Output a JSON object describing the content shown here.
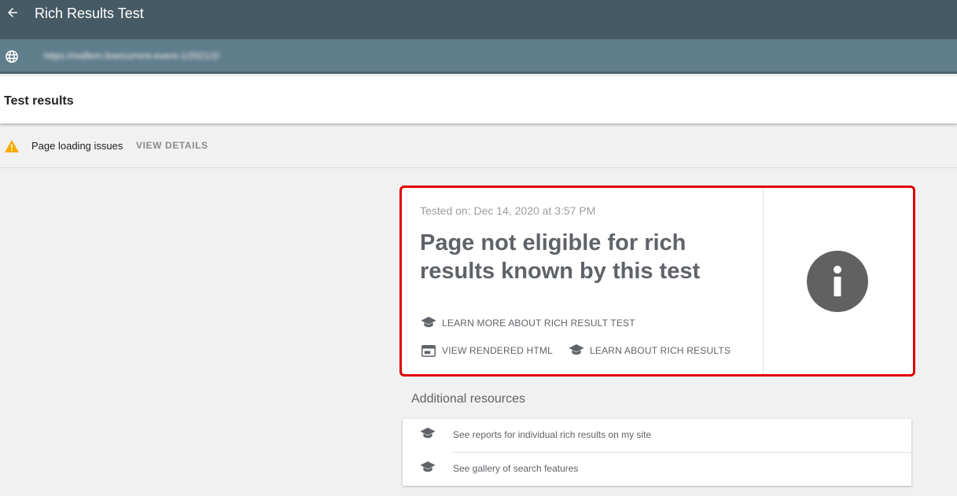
{
  "app": {
    "title": "Rich Results Test",
    "back_icon": "arrow-left-icon"
  },
  "url_bar": {
    "icon": "globe-icon",
    "url": "https://redfern.live/current-event-1/2021/2/"
  },
  "results_header": {
    "title": "Test results"
  },
  "issues": {
    "icon": "warning-icon",
    "text": "Page loading issues",
    "action": "VIEW DETAILS",
    "icon_color": "#f9ab00"
  },
  "result_card": {
    "tested_on": "Tested on: Dec 14, 2020 at 3:57 PM",
    "headline": "Page not eligible for rich results known by this test",
    "links": [
      {
        "label": "LEARN MORE ABOUT RICH RESULT TEST",
        "icon": "graduation-cap-icon"
      },
      {
        "label": "VIEW RENDERED HTML",
        "icon": "browser-window-icon"
      },
      {
        "label": "LEARN ABOUT RICH RESULTS",
        "icon": "graduation-cap-icon"
      }
    ],
    "status_icon": "info-icon",
    "highlight_color": "#e00000"
  },
  "additional_resources": {
    "title": "Additional resources",
    "items": [
      {
        "label": "See reports for individual rich results on my site",
        "icon": "graduation-cap-icon"
      },
      {
        "label": "See gallery of search features",
        "icon": "graduation-cap-icon"
      }
    ]
  },
  "colors": {
    "topbar": "#455a64",
    "urlbar": "#607d8b",
    "background": "#f1f1f1"
  }
}
